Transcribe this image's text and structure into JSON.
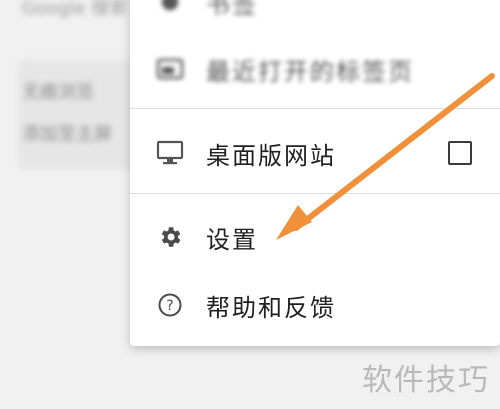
{
  "background": {
    "line1": "Google 搜索",
    "line2": "无痕浏览",
    "line3": "添加至主屏"
  },
  "menu": {
    "items": [
      {
        "label": "书签",
        "icon": "star-icon"
      },
      {
        "label": "最近打开的标签页",
        "icon": "recent-tabs-icon"
      },
      {
        "label": "桌面版网站",
        "icon": "desktop-icon",
        "checked": false
      },
      {
        "label": "设置",
        "icon": "gear-icon"
      },
      {
        "label": "帮助和反馈",
        "icon": "help-icon"
      }
    ]
  },
  "annotation": {
    "arrow_color": "#f0903a"
  },
  "watermark": "软件技巧"
}
